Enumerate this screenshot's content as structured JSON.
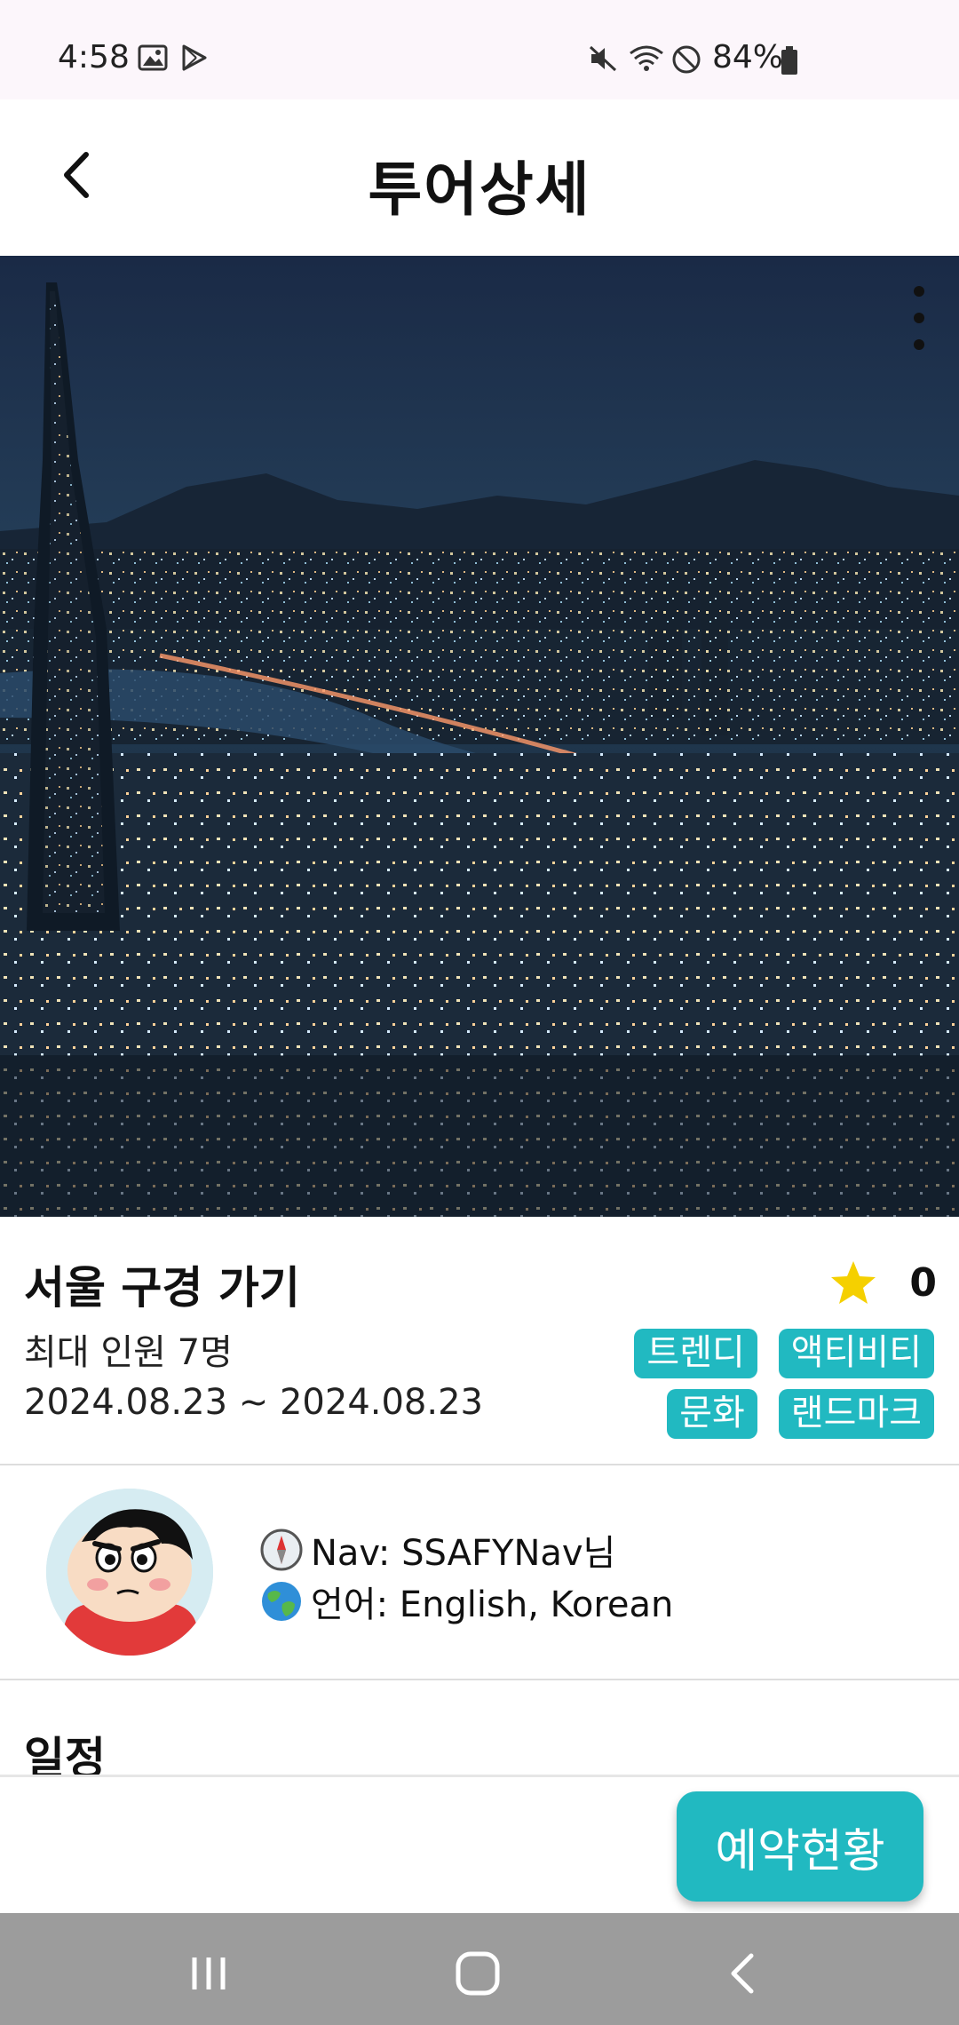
{
  "status_bar": {
    "time": "4:58",
    "battery_percent": "84%",
    "icons": [
      "gallery-icon",
      "play-store-icon",
      "mute-icon",
      "wifi-icon",
      "do-not-disturb-icon",
      "battery-icon"
    ]
  },
  "header": {
    "title": "투어상세",
    "back_icon": "chevron-left-icon"
  },
  "hero": {
    "menu_icon": "more-vertical-icon"
  },
  "tour": {
    "name": "서울 구경 가기",
    "max_people": "최대 인원 7명",
    "dates": "2024.08.23 ~ 2024.08.23",
    "rating": "0",
    "rating_icon": "star-icon",
    "rating_color": "#f5d000",
    "tags": [
      "트렌디",
      "액티비티",
      "문화",
      "랜드마크"
    ],
    "tag_color": "#21b9c1"
  },
  "guide": {
    "nav_line": "Nav: SSAFYNav님",
    "language_line": "언어: English, Korean"
  },
  "schedule": {
    "title": "일정"
  },
  "actions": {
    "reserve_label": "예약현황"
  },
  "nav_bar": {
    "buttons": [
      "recent-apps-icon",
      "home-icon",
      "back-icon"
    ]
  }
}
